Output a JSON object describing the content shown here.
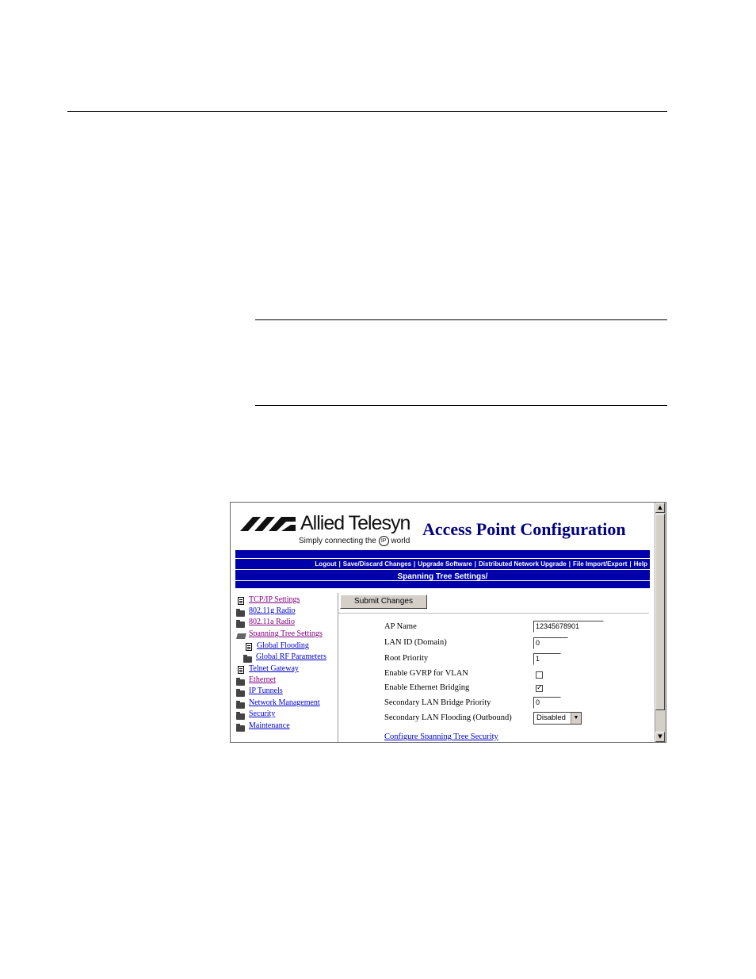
{
  "header": {
    "brand": "Allied Telesyn",
    "tagline_before": "Simply connecting the",
    "tagline_ip": "IP",
    "tagline_after": "world",
    "app_title": "Access Point Configuration"
  },
  "nav": {
    "links": [
      "Logout",
      "Save/Discard Changes",
      "Upgrade Software",
      "Distributed Network Upgrade",
      "File Import/Export",
      "Help"
    ],
    "section_title": "Spanning Tree Settings/"
  },
  "sidebar": {
    "items": [
      {
        "label": "TCP/IP Settings",
        "icon": "document-icon"
      },
      {
        "label": "802.11g Radio",
        "icon": "folder-icon"
      },
      {
        "label": "802.11a Radio",
        "icon": "folder-icon"
      },
      {
        "label": "Spanning Tree Settings",
        "icon": "open-folder-icon"
      },
      {
        "label": "Global Flooding",
        "icon": "document-icon"
      },
      {
        "label": "Global RF Parameters",
        "icon": "folder-icon"
      },
      {
        "label": "Telnet Gateway",
        "icon": "document-icon"
      },
      {
        "label": "Ethernet",
        "icon": "folder-icon"
      },
      {
        "label": "IP Tunnels",
        "icon": "folder-icon"
      },
      {
        "label": "Network Management",
        "icon": "folder-icon"
      },
      {
        "label": "Security",
        "icon": "folder-icon"
      },
      {
        "label": "Maintenance",
        "icon": "folder-icon"
      }
    ]
  },
  "form": {
    "submit_label": "Submit Changes",
    "ap_name_label": "AP Name",
    "ap_name_value": "12345678901",
    "lan_id_label": "LAN ID (Domain)",
    "lan_id_value": "0",
    "root_priority_label": "Root Priority",
    "root_priority_value": "1",
    "gvrp_label": "Enable GVRP for VLAN",
    "gvrp_checked": false,
    "eth_bridging_label": "Enable Ethernet Bridging",
    "eth_bridging_mark": "✓",
    "sec_bridge_priority_label": "Secondary LAN Bridge Priority",
    "sec_bridge_priority_value": "0",
    "sec_flooding_label": "Secondary LAN Flooding (Outbound)",
    "sec_flooding_value": "Disabled",
    "config_link": "Configure Spanning Tree Security"
  },
  "colors": {
    "navbar": "#0000aa",
    "title": "#000080",
    "link": "#0000cc",
    "visited": "#800080"
  }
}
